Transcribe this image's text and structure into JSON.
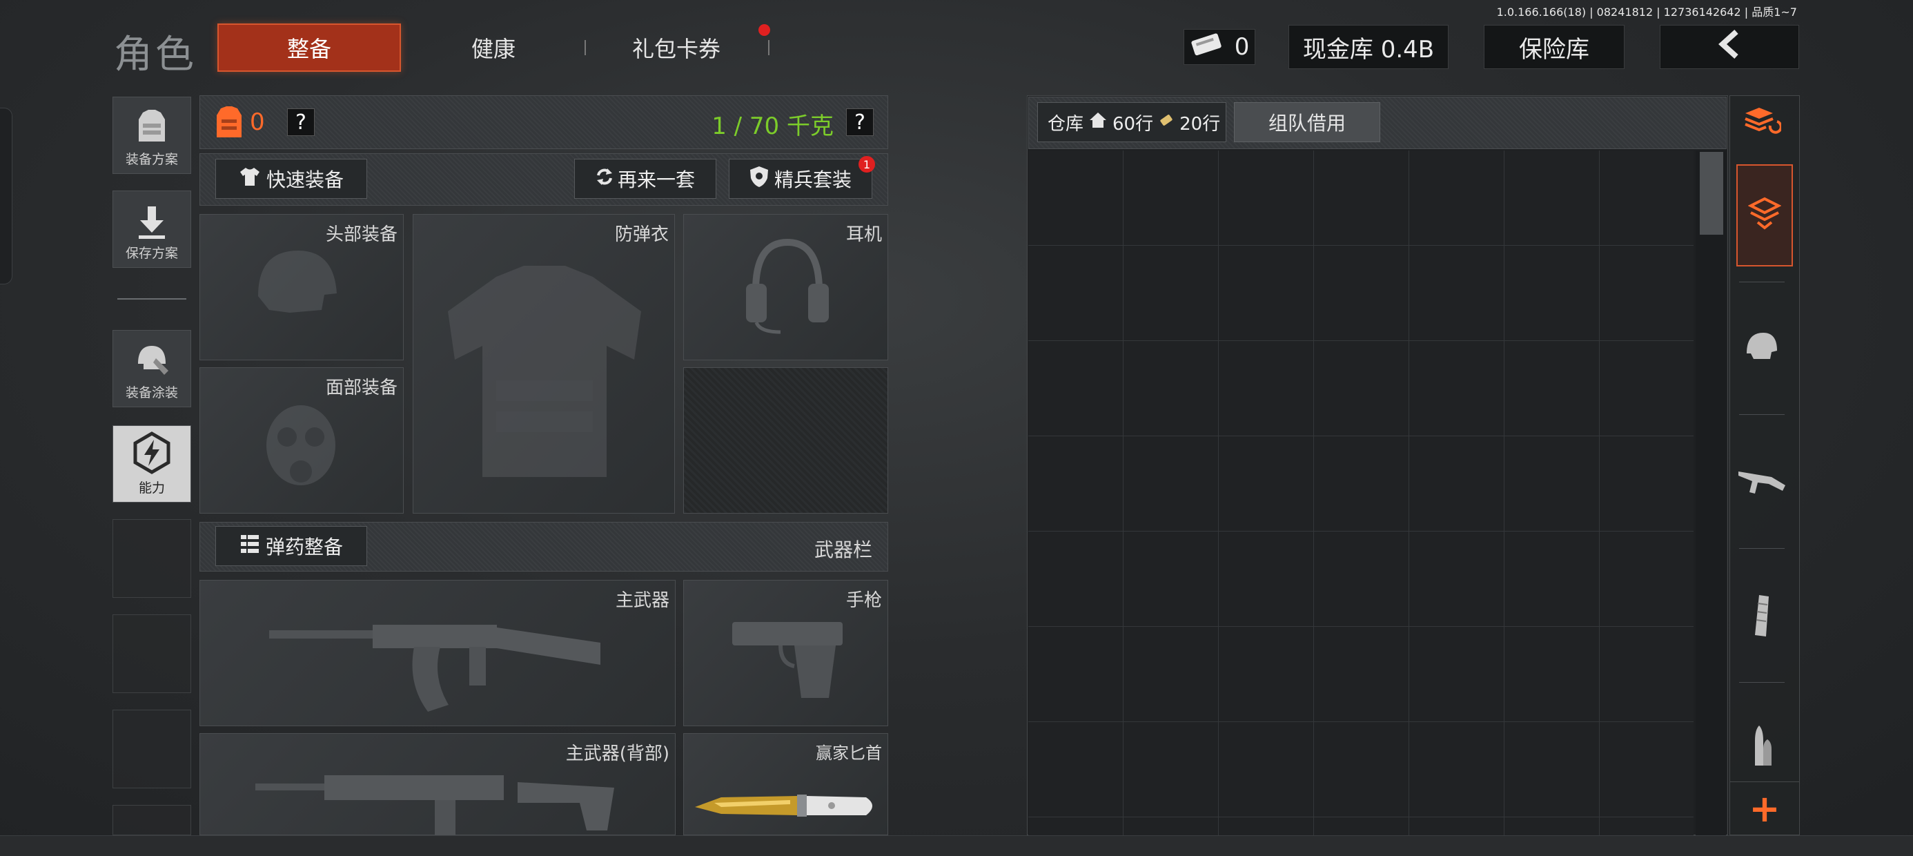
{
  "version_info": "1.0.166.166(18) | 08241812 | 12736142642 | 品质1~7",
  "header": {
    "page_title": "角色",
    "tabs": [
      {
        "label": "整备",
        "active": true
      },
      {
        "label": "健康",
        "active": false
      },
      {
        "label": "礼包卡券",
        "active": false,
        "notification_dot": true
      }
    ],
    "ticket_count": "0",
    "cash_vault": "现金库 0.4B",
    "safe_box": "保险库",
    "back_icon": "chevron-left-icon"
  },
  "left_sidebar": {
    "buttons": [
      {
        "label": "装备方案",
        "icon": "vest-icon"
      },
      {
        "label": "保存方案",
        "icon": "download-icon"
      },
      {
        "label": "装备涂装",
        "icon": "helmet-skin-icon"
      },
      {
        "label": "能力",
        "icon": "ability-icon",
        "active": true
      }
    ]
  },
  "loadout": {
    "armor_value": "0",
    "help": "?",
    "weight": "1 / 70 千克",
    "quick_equip": "快速装备",
    "another_set": "再来一套",
    "elite_set": "精兵套装",
    "elite_badge": "1",
    "slots": {
      "head": "头部装备",
      "vest": "防弹衣",
      "headset": "耳机",
      "face": "面部装备"
    },
    "ammo_equip": "弹药整备",
    "weapon_bar": "武器栏",
    "weapons": {
      "primary": "主武器",
      "pistol": "手枪",
      "primary_back": "主武器(背部)",
      "knife": "赢家匕首"
    }
  },
  "warehouse": {
    "label": "仓库",
    "rows_home": "60行",
    "rows_extra": "20行",
    "team_borrow": "组队借用"
  },
  "right_sidebar": {
    "tabs": [
      "sort-refresh-icon",
      "layers-icon",
      "helmet-icon",
      "rifle-icon",
      "magazine-icon",
      "bullet-icon"
    ],
    "add": "+"
  },
  "colors": {
    "accent": "#d7562e",
    "weight_green": "#7ccc2a",
    "armor_orange": "#ff6a2a",
    "badge_red": "#e02020"
  }
}
